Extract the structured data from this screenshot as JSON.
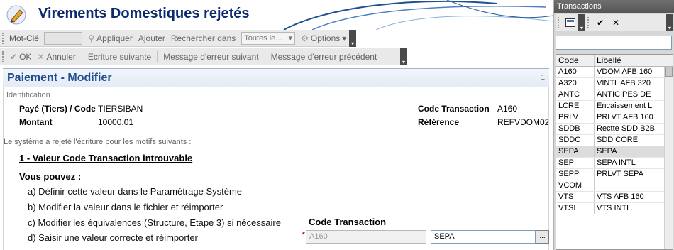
{
  "main": {
    "title": "Virements Domestiques rejetés",
    "toolbar1": {
      "keyword_label": "Mot-Clé",
      "apply": "Appliquer",
      "add": "Ajouter",
      "search_in": "Rechercher dans",
      "search_in_value": "Toutes le...",
      "options": "Options"
    },
    "toolbar2": {
      "ok": "OK",
      "cancel": "Annuler",
      "next_entry": "Ecriture suivante",
      "next_error": "Message d'erreur suivant",
      "prev_error": "Message d'erreur précédent"
    },
    "form": {
      "title": "Paiement - Modifier",
      "page": "1",
      "section": "Identification",
      "payee_label": "Payé (Tiers) / Code",
      "payee_value": "TIERSIBAN",
      "amount_label": "Montant",
      "amount_value": "10000.01",
      "txcode_label": "Code Transaction",
      "txcode_value": "A160",
      "ref_label": "Référence",
      "ref_value": "REFVDOM02",
      "reject_text": "Le système a rejeté l'écriture pour les motifs suivants :",
      "reason": "1 - Valeur Code Transaction introuvable",
      "you_can": "Vous pouvez :",
      "opt_a": "a) Définir cette valeur dans le Paramétrage Système",
      "opt_b": "b) Modifier la valeur dans le fichier et réimporter",
      "opt_c": "c) Modifier les équivalences (Structure, Etape 3) si nécessaire",
      "opt_d": "d) Saisir une valeur correcte et réimporter",
      "field_label": "Code Transaction",
      "required_mark": "*",
      "field_old": "A160",
      "field_new": "SEPA",
      "ellipsis": "..."
    }
  },
  "panel": {
    "title": "Transactions",
    "col_code": "Code",
    "col_label": "Libellé",
    "rows": [
      {
        "code": "A160",
        "label": "VDOM AFB 160"
      },
      {
        "code": "A320",
        "label": "VINTL AFB 320"
      },
      {
        "code": "ANTC",
        "label": "ANTICIPES DE"
      },
      {
        "code": "LCRE",
        "label": "Encaissement L"
      },
      {
        "code": "PRLV",
        "label": "PRLVT AFB 160"
      },
      {
        "code": "SDDB",
        "label": "Rectte SDD B2B"
      },
      {
        "code": "SDDC",
        "label": "SDD CORE"
      },
      {
        "code": "SEPA",
        "label": "SEPA"
      },
      {
        "code": "SEPI",
        "label": "SEPA INTL"
      },
      {
        "code": "SEPP",
        "label": "PRLVT SEPA"
      },
      {
        "code": "VCOM",
        "label": ""
      },
      {
        "code": "VTS",
        "label": "VTS AFB 160"
      },
      {
        "code": "VTSI",
        "label": "VTS INTL."
      }
    ],
    "selected": "SEPA"
  }
}
